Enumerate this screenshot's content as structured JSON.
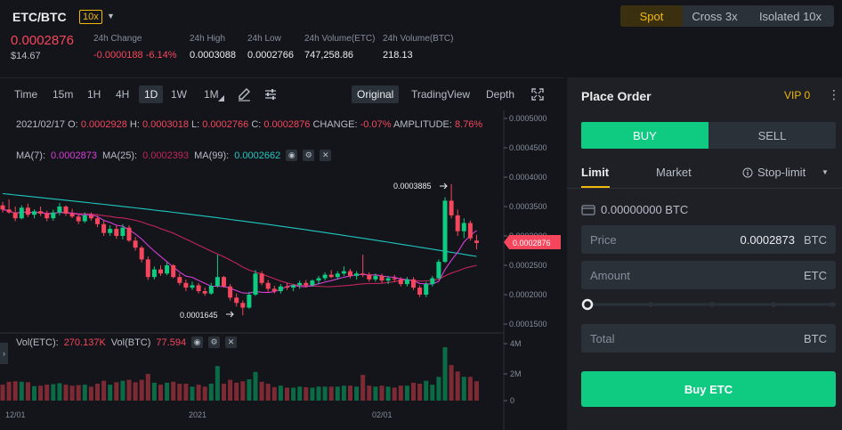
{
  "header": {
    "pair": "ETC/BTC",
    "leverage": "10x",
    "last_price": "0.0002876",
    "last_price_usd": "$14.67",
    "stats": [
      {
        "label": "24h Change",
        "value": "-0.0000188 -6.14%"
      },
      {
        "label": "24h High",
        "value": "0.0003088"
      },
      {
        "label": "24h Low",
        "value": "0.0002766"
      },
      {
        "label": "24h Volume(ETC)",
        "value": "747,258.86"
      },
      {
        "label": "24h Volume(BTC)",
        "value": "218.13"
      }
    ],
    "modes": [
      "Spot",
      "Cross 3x",
      "Isolated 10x"
    ]
  },
  "chart": {
    "toolbar": [
      "Time",
      "15m",
      "1H",
      "4H",
      "1D",
      "1W",
      "1M"
    ],
    "views": [
      "Original",
      "TradingView",
      "Depth"
    ],
    "ohlc": {
      "date": "2021/02/17",
      "o_label": "O:",
      "o": "0.0002928",
      "h_label": "H:",
      "h": "0.0003018",
      "l_label": "L:",
      "l": "0.0002766",
      "c_label": "C:",
      "c": "0.0002876",
      "change_label": "CHANGE:",
      "change": "-0.07%",
      "amp_label": "AMPLITUDE:",
      "amp": "8.76%"
    },
    "ma": {
      "ma7_label": "MA(7):",
      "ma7": "0.0002873",
      "ma25_label": "MA(25):",
      "ma25": "0.0002393",
      "ma99_label": "MA(99):",
      "ma99": "0.0002662"
    },
    "volume": {
      "etc_label": "Vol(ETC):",
      "etc": "270.137K",
      "btc_label": "Vol(BTC)",
      "btc": "77.594"
    },
    "colors": {
      "up": "#0ecb81",
      "down": "#f6465d",
      "ma7": "#d63ed9",
      "ma25": "#c2255c",
      "ma99": "#1fc7c1"
    },
    "high_annotation": "0.0003885",
    "low_annotation": "0.0001645",
    "current_price_tag": "0.0002876",
    "price_axis": [
      "0.0005000",
      "0.0004500",
      "0.0004000",
      "0.0003500",
      "0.0003000",
      "0.0002500",
      "0.0002000",
      "0.0001500"
    ],
    "volume_axis": [
      "4M",
      "2M",
      "0"
    ],
    "time_axis": [
      "12/01",
      "2021",
      "02/01"
    ]
  },
  "chart_data": {
    "type": "candlestick",
    "x_labels": [
      "12/01",
      "2021",
      "02/01"
    ],
    "ylim": [
      0.00015,
      0.0005
    ],
    "candles_ohlc": [
      [
        0.000352,
        0.000358,
        0.00034,
        0.000345
      ],
      [
        0.000345,
        0.000362,
        0.000338,
        0.00034
      ],
      [
        0.00034,
        0.00035,
        0.000325,
        0.00033
      ],
      [
        0.00033,
        0.000352,
        0.000328,
        0.000348
      ],
      [
        0.000348,
        0.000355,
        0.000332,
        0.000336
      ],
      [
        0.000336,
        0.000345,
        0.00033,
        0.000342
      ],
      [
        0.000342,
        0.00035,
        0.000334,
        0.000338
      ],
      [
        0.000338,
        0.000343,
        0.000325,
        0.00033
      ],
      [
        0.00033,
        0.000345,
        0.000326,
        0.00034
      ],
      [
        0.00034,
        0.000356,
        0.000335,
        0.00035
      ],
      [
        0.00035,
        0.000352,
        0.000334,
        0.000338
      ],
      [
        0.000338,
        0.000346,
        0.00033,
        0.000333
      ],
      [
        0.000333,
        0.000337,
        0.00032,
        0.000325
      ],
      [
        0.000325,
        0.00034,
        0.000322,
        0.000335
      ],
      [
        0.000335,
        0.00034,
        0.000326,
        0.00033
      ],
      [
        0.00033,
        0.000335,
        0.000315,
        0.00032
      ],
      [
        0.00032,
        0.000326,
        0.0003,
        0.000305
      ],
      [
        0.000305,
        0.000318,
        0.0003,
        0.000312
      ],
      [
        0.000312,
        0.000318,
        0.000295,
        0.0003
      ],
      [
        0.0003,
        0.00032,
        0.000294,
        0.000314
      ],
      [
        0.000314,
        0.000318,
        0.00029,
        0.000292
      ],
      [
        0.000292,
        0.000298,
        0.000275,
        0.00028
      ],
      [
        0.00028,
        0.000283,
        0.000255,
        0.00026
      ],
      [
        0.00026,
        0.000265,
        0.000225,
        0.00023
      ],
      [
        0.00023,
        0.000248,
        0.000226,
        0.000243
      ],
      [
        0.000243,
        0.00025,
        0.000232,
        0.000236
      ],
      [
        0.000236,
        0.000255,
        0.000233,
        0.00025
      ],
      [
        0.00025,
        0.000252,
        0.000228,
        0.00023
      ],
      [
        0.00023,
        0.000236,
        0.000216,
        0.00022
      ],
      [
        0.00022,
        0.000226,
        0.000206,
        0.000212
      ],
      [
        0.000212,
        0.000222,
        0.000208,
        0.000216
      ],
      [
        0.000216,
        0.00022,
        0.000202,
        0.000206
      ],
      [
        0.000206,
        0.000212,
        0.000198,
        0.000202
      ],
      [
        0.000202,
        0.00022,
        0.0002,
        0.000215
      ],
      [
        0.000215,
        0.000268,
        0.000212,
        0.00023
      ],
      [
        0.00023,
        0.000232,
        0.000212,
        0.000214
      ],
      [
        0.000214,
        0.000218,
        0.00019,
        0.000195
      ],
      [
        0.000195,
        0.000202,
        0.00018,
        0.000186
      ],
      [
        0.000186,
        0.00019,
        0.000165,
        0.000178
      ],
      [
        0.000178,
        0.000205,
        0.000176,
        0.0002
      ],
      [
        0.0002,
        0.000242,
        0.000198,
        0.000236
      ],
      [
        0.000236,
        0.00024,
        0.000216,
        0.00022
      ],
      [
        0.00022,
        0.000225,
        0.000205,
        0.00021
      ],
      [
        0.00021,
        0.000215,
        0.000202,
        0.000206
      ],
      [
        0.000206,
        0.000218,
        0.000202,
        0.000214
      ],
      [
        0.000214,
        0.00022,
        0.000208,
        0.000212
      ],
      [
        0.000212,
        0.000218,
        0.000206,
        0.000216
      ],
      [
        0.000216,
        0.000224,
        0.00021,
        0.00022
      ],
      [
        0.00022,
        0.000225,
        0.000212,
        0.000216
      ],
      [
        0.000216,
        0.000226,
        0.000214,
        0.000224
      ],
      [
        0.000224,
        0.000232,
        0.000218,
        0.000228
      ],
      [
        0.000228,
        0.000238,
        0.000224,
        0.000234
      ],
      [
        0.000234,
        0.000242,
        0.000228,
        0.00023
      ],
      [
        0.00023,
        0.00024,
        0.000226,
        0.000236
      ],
      [
        0.000236,
        0.000248,
        0.000232,
        0.00024
      ],
      [
        0.00024,
        0.000244,
        0.000228,
        0.000232
      ],
      [
        0.000232,
        0.00024,
        0.000226,
        0.000236
      ],
      [
        0.000236,
        0.000268,
        0.00023,
        0.000234
      ],
      [
        0.000234,
        0.000238,
        0.000222,
        0.000226
      ],
      [
        0.000226,
        0.000236,
        0.000222,
        0.000232
      ],
      [
        0.000232,
        0.000236,
        0.00022,
        0.000224
      ],
      [
        0.000224,
        0.000232,
        0.000218,
        0.000228
      ],
      [
        0.000228,
        0.000234,
        0.000222,
        0.000226
      ],
      [
        0.000226,
        0.00023,
        0.000214,
        0.000218
      ],
      [
        0.000218,
        0.00023,
        0.000214,
        0.000226
      ],
      [
        0.000226,
        0.00023,
        0.000208,
        0.000212
      ],
      [
        0.000212,
        0.000216,
        0.000196,
        0.0002
      ],
      [
        0.0002,
        0.000222,
        0.000196,
        0.000218
      ],
      [
        0.000218,
        0.000232,
        0.000214,
        0.000228
      ],
      [
        0.000228,
        0.00026,
        0.000226,
        0.000256
      ],
      [
        0.000256,
        0.000366,
        0.000254,
        0.00036
      ],
      [
        0.00036,
        0.000388,
        0.00033,
        0.000335
      ],
      [
        0.000335,
        0.000345,
        0.0003,
        0.000308
      ],
      [
        0.000308,
        0.00033,
        0.000296,
        0.000322
      ],
      [
        0.000322,
        0.000326,
        0.000292,
        0.000296
      ],
      [
        0.000292,
        0.000302,
        0.000277,
        0.000288
      ]
    ]
  },
  "order": {
    "title": "Place Order",
    "vip": "VIP 0",
    "buy_tab": "BUY",
    "sell_tab": "SELL",
    "types": [
      "Limit",
      "Market",
      "Stop-limit"
    ],
    "balance": "0.00000000 BTC",
    "price_label": "Price",
    "price_value": "0.0002873",
    "price_unit": "BTC",
    "amount_label": "Amount",
    "amount_unit": "ETC",
    "total_label": "Total",
    "total_unit": "BTC",
    "submit": "Buy ETC"
  }
}
